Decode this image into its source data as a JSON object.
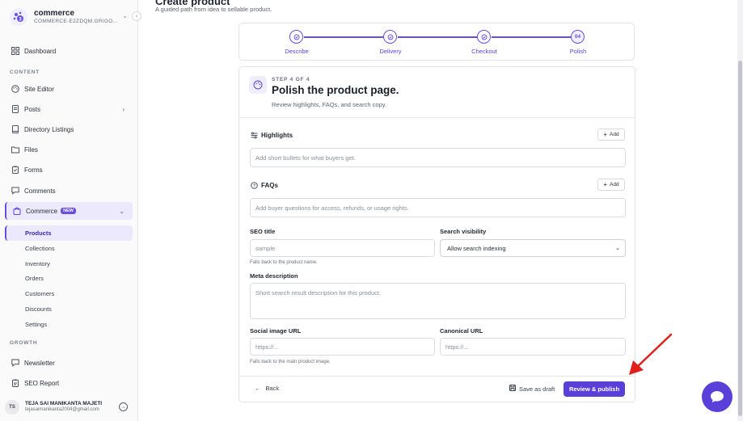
{
  "brand": {
    "name": "commerce",
    "site_id": "COMMERCE-E2ZDQM.GRIGO..."
  },
  "sidebar": {
    "dashboard": "Dashboard",
    "section_content": "CONTENT",
    "site_editor": "Site Editor",
    "posts": "Posts",
    "directory": "Directory Listings",
    "files": "Files",
    "forms": "Forms",
    "comments": "Comments",
    "commerce": "Commerce",
    "commerce_badge": "NEW",
    "sub": [
      "Products",
      "Collections",
      "Inventory",
      "Orders",
      "Customers",
      "Discounts",
      "Settings"
    ],
    "section_growth": "GROWTH",
    "newsletter": "Newsletter",
    "seo_report": "SEO Report"
  },
  "user": {
    "initials": "TS",
    "name": "TEJA SAI MANIKANTA MAJETI",
    "email": "tejasaimanikanta2004@gmail.com"
  },
  "header": {
    "title": "Create product",
    "subtitle": "A guided path from idea to sellable product."
  },
  "stepper": {
    "steps": [
      {
        "label": "Describe",
        "marker": "check"
      },
      {
        "label": "Delivery",
        "marker": "check"
      },
      {
        "label": "Checkout",
        "marker": "check"
      },
      {
        "label": "Polish",
        "marker": "04"
      }
    ]
  },
  "card": {
    "step_of": "STEP 4 OF 4",
    "title": "Polish the product page.",
    "subtitle": "Review highlights, FAQs, and search copy."
  },
  "highlights": {
    "title": "Highlights",
    "add": "Add",
    "placeholder": "Add short bullets for what buyers get."
  },
  "faqs": {
    "title": "FAQs",
    "add": "Add",
    "placeholder": "Add buyer questions for access, refunds, or usage rights."
  },
  "seo": {
    "title_label": "SEO title",
    "title_value": "sample",
    "title_hint": "Falls back to the product name.",
    "visibility_label": "Search visibility",
    "visibility_value": "Allow search indexing",
    "meta_label": "Meta description",
    "meta_placeholder": "Short search result description for this product.",
    "social_label": "Social image URL",
    "social_placeholder": "https://...",
    "social_hint": "Falls back to the main product image.",
    "canonical_label": "Canonical URL",
    "canonical_placeholder": "https://..."
  },
  "footer": {
    "back": "Back",
    "draft": "Save as draft",
    "publish": "Review & publish"
  },
  "colors": {
    "accent": "#5b3fd9",
    "arrow": "#e0201b"
  }
}
